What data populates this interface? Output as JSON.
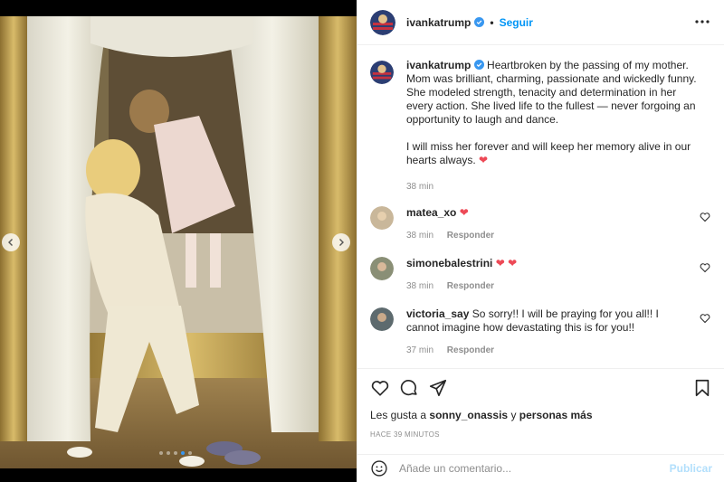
{
  "post": {
    "username": "ivankatrump",
    "follow_label": "Seguir",
    "separator": "•",
    "caption": {
      "username": "ivankatrump",
      "text_1": "Heartbroken by the passing of my mother. Mom was brilliant, charming, passionate and wickedly funny. She modeled strength, tenacity and determination in her every action. She lived life to the fullest — never forgoing an opportunity to laugh and dance.",
      "text_2": "I will miss her forever and will keep her memory alive in our hearts always.",
      "time": "38 min"
    },
    "comments": [
      {
        "username": "matea_xo",
        "text": "",
        "emoji": "❤",
        "time": "38 min",
        "reply": "Responder"
      },
      {
        "username": "simonebalestrini",
        "text": "",
        "emoji": "❤ ❤",
        "time": "38 min",
        "reply": "Responder"
      },
      {
        "username": "victoria_say",
        "text": "So sorry!! I will be praying for you all!! I cannot imagine how devastating this is for you!!",
        "emoji": "",
        "time": "37 min",
        "reply": "Responder"
      }
    ],
    "likes": {
      "prefix": "Les gusta a",
      "user": "sonny_onassis",
      "connector": "y",
      "others": "personas más"
    },
    "posted_ago": "HACE 39 MINUTOS",
    "add_comment_placeholder": "Añade un comentario...",
    "publish_label": "Publicar"
  },
  "carousel": {
    "total": 5,
    "active": 4
  },
  "colors": {
    "link": "#0095f6",
    "heart": "#ed4956",
    "muted": "#8e8e8e",
    "publish_disabled": "#b2dffc"
  },
  "icons": [
    "chevron-left-icon",
    "chevron-right-icon",
    "more-options-icon",
    "verified-badge-icon",
    "heart-outline-icon",
    "comment-icon",
    "share-icon",
    "bookmark-icon",
    "emoji-icon"
  ]
}
